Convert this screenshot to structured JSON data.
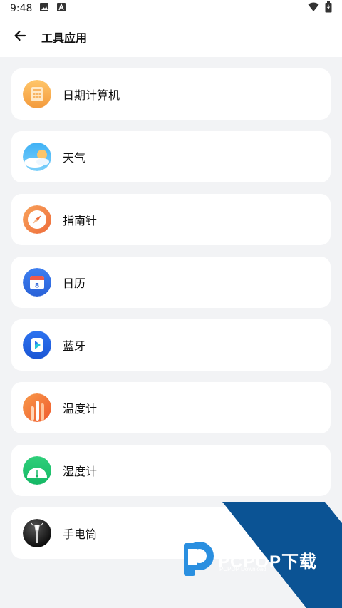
{
  "status_bar": {
    "time": "9:48",
    "icons": [
      "image-icon",
      "a-icon"
    ],
    "right_icons": [
      "wifi-icon",
      "battery-icon"
    ]
  },
  "header": {
    "title": "工具应用",
    "back_icon": "arrow-left-icon"
  },
  "tools": [
    {
      "label": "日期计算机",
      "icon": "date-calculator-icon"
    },
    {
      "label": "天气",
      "icon": "weather-icon"
    },
    {
      "label": "指南针",
      "icon": "compass-icon"
    },
    {
      "label": "日历",
      "icon": "calendar-icon",
      "calendar_day": "8"
    },
    {
      "label": "蓝牙",
      "icon": "bluetooth-icon"
    },
    {
      "label": "温度计",
      "icon": "thermometer-icon"
    },
    {
      "label": "湿度计",
      "icon": "hygrometer-icon"
    },
    {
      "label": "手电筒",
      "icon": "flashlight-icon"
    }
  ],
  "watermark": {
    "title": "PCPOP下载",
    "subtitle": "PCPOP Download"
  },
  "colors": {
    "background": "#f2f3f5",
    "card": "#ffffff",
    "watermark_blue": "#0b5394"
  }
}
